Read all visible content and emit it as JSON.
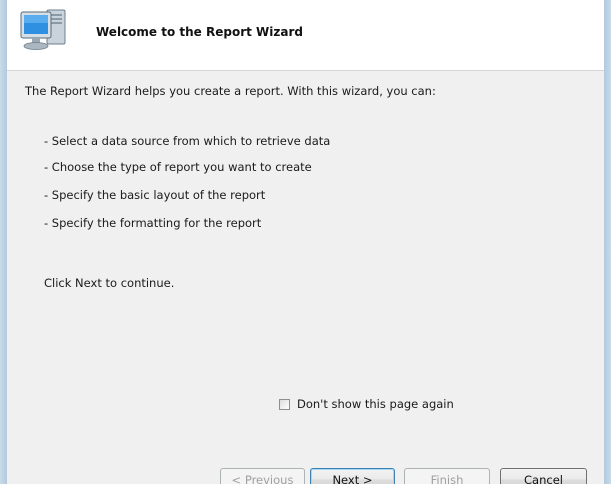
{
  "header": {
    "title": "Welcome to the Report Wizard",
    "icon": "computer-monitor-icon"
  },
  "body": {
    "intro": "The Report Wizard helps you create a report. With this wizard, you can:",
    "bullets": [
      "- Select a data source from which to retrieve data",
      "- Choose the type of report you want to create",
      "- Specify the basic layout of the report",
      "- Specify the formatting for the report"
    ],
    "continue_text": "Click Next to continue."
  },
  "checkbox": {
    "label": "Don't show this page again",
    "checked": false
  },
  "buttons": {
    "previous": "< Previous",
    "next": "Next >",
    "finish": "Finish",
    "cancel": "Cancel"
  }
}
